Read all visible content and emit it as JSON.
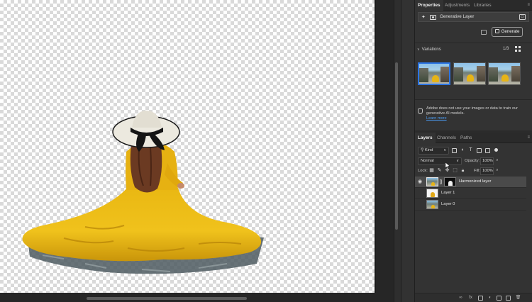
{
  "properties_panel": {
    "tabs": [
      "Properties",
      "Adjustments",
      "Libraries"
    ],
    "layer_type": "Generative Layer",
    "generate_label": "Generate",
    "variations_title": "Variations",
    "variations_count": "1/3",
    "privacy_text": "Adobe does not use your images or data to train our generative AI models.",
    "learn_more": "Learn more"
  },
  "layers_panel": {
    "tabs": [
      "Layers",
      "Channels",
      "Paths"
    ],
    "filter_kind": "Kind",
    "blend_mode": "Normal",
    "opacity_label": "Opacity:",
    "opacity_value": "100%",
    "lock_label": "Lock:",
    "fill_label": "Fill:",
    "fill_value": "100%",
    "layers": [
      {
        "name": "Harmonized layer",
        "visible": true,
        "selected": true
      },
      {
        "name": "Layer 1",
        "visible": false,
        "selected": false
      },
      {
        "name": "Layer 0",
        "visible": false,
        "selected": false
      }
    ]
  },
  "colors": {
    "accent": "#2b74e3",
    "link": "#4b9cf2",
    "dress_yellow": "#e6b417"
  }
}
